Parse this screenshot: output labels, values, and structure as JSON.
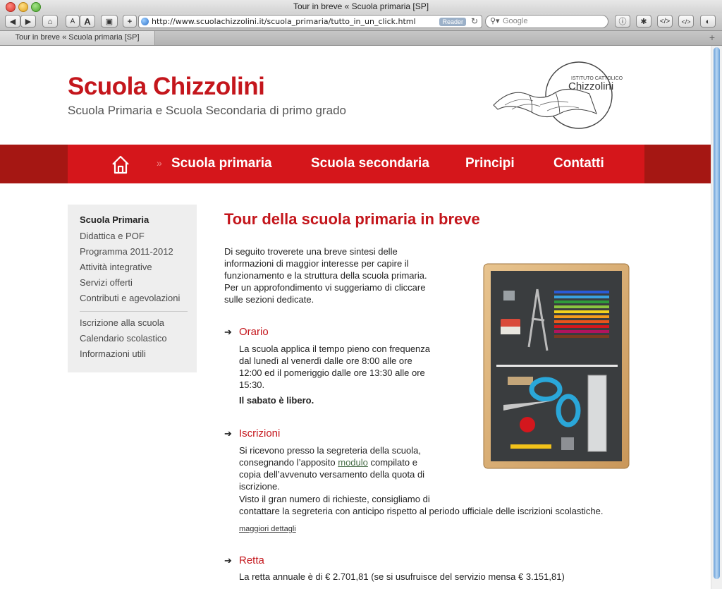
{
  "window": {
    "title": "Tour in breve « Scuola primaria [SP]",
    "url": "http://www.scuolachizzolini.it/scuola_primaria/tutto_in_un_click.html",
    "reader_label": "Reader",
    "search_placeholder": "Google",
    "tab_label": "Tour in breve « Scuola primaria [SP]",
    "font_small": "A",
    "font_large": "A"
  },
  "site": {
    "title": "Scuola Chizzolini",
    "subtitle": "Scuola Primaria e Scuola Secondaria di primo grado",
    "logo_top": "ISTITUTO CATTOLICO",
    "logo_name": "Chizzolini"
  },
  "nav": {
    "arrow": "»",
    "items": [
      "Scuola primaria",
      "Scuola secondaria",
      "Principi",
      "Contatti"
    ]
  },
  "sidebar": {
    "items": [
      "Scuola Primaria",
      "Didattica e POF",
      "Programma 2011-2012",
      "Attività integrative",
      "Servizi offerti",
      "Contributi e agevolazioni",
      "Iscrizione alla scuola",
      "Calendario scolastico",
      "Informazioni utili"
    ]
  },
  "main": {
    "heading": "Tour della scuola primaria in breve",
    "intro": [
      "Di seguito troverete una breve sintesi delle",
      "informazioni di maggior interesse per capire il",
      "funzionamento e la struttura della scuola primaria.",
      "Per un approfondimento vi suggeriamo di cliccare",
      "sulle sezioni dedicate."
    ],
    "arrow": "➔",
    "sections": {
      "orario": {
        "title": "Orario",
        "lines": [
          "La scuola applica il tempo pieno con frequenza",
          "dal lunedì al venerdì dalle ore 8:00 alle ore",
          "12:00 ed il pomeriggio dalle ore 13:30 alle ore",
          "15:30."
        ],
        "bold": "Il sabato è libero."
      },
      "iscrizioni": {
        "title": "Iscrizioni",
        "line1": "Si ricevono presso la segreteria della scuola,",
        "line2_pre": "consegnando l’apposito ",
        "line2_link": "modulo",
        "line2_post": " compilato e",
        "line3": "copia dell’avvenuto versamento della quota di",
        "line4": "iscrizione.",
        "line5": "Visto il gran numero di richieste, consigliamo di",
        "line6": "contattare la segreteria con anticipo rispetto al periodo ufficiale delle iscrizioni scolastiche.",
        "more": "maggiori dettagli"
      },
      "retta": {
        "title": "Retta",
        "line1": "La retta annuale è di € 2.701,81 (se si usufruisce del servizio mensa € 3.151,81)"
      }
    }
  }
}
